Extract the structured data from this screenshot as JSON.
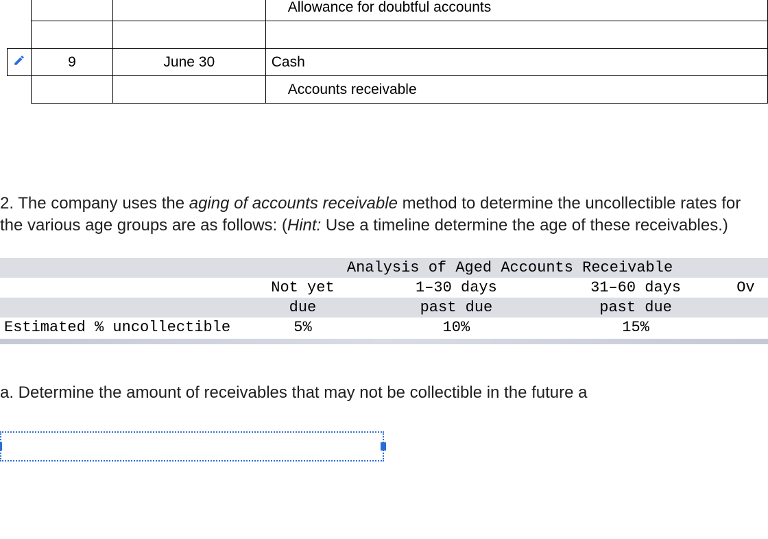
{
  "journal": {
    "rows": [
      {
        "num": "",
        "date": "",
        "account": "Allowance for doubtful accounts",
        "indent": true,
        "edit": false
      },
      {
        "num": "",
        "date": "",
        "account": "",
        "indent": false,
        "edit": false
      },
      {
        "num": "9",
        "date": "June 30",
        "account": "Cash",
        "indent": false,
        "edit": true
      },
      {
        "num": "",
        "date": "",
        "account": "Accounts receivable",
        "indent": true,
        "edit": false
      }
    ]
  },
  "question2": {
    "prefix": "2. The company uses the ",
    "italic1": "aging of accounts receivable",
    "mid1": " method to determine the uncollectible rates for the various age groups are as follows: (",
    "italic2": "Hint:",
    "mid2": " Use a timeline determine the age of these receivables.)"
  },
  "aging": {
    "title": "Analysis of Aged Accounts Receivable",
    "row_label": "Estimated % uncollectible",
    "cols": [
      {
        "h1": "Not yet",
        "h2": "due",
        "val": "5%"
      },
      {
        "h1": "1–30 days",
        "h2": "past due",
        "val": "10%"
      },
      {
        "h1": "31–60 days",
        "h2": "past due",
        "val": "15%"
      },
      {
        "h1": "Ov",
        "h2": "",
        "val": ""
      }
    ]
  },
  "subq_a": "a. Determine the amount of receivables that may not be collectible in the future a"
}
